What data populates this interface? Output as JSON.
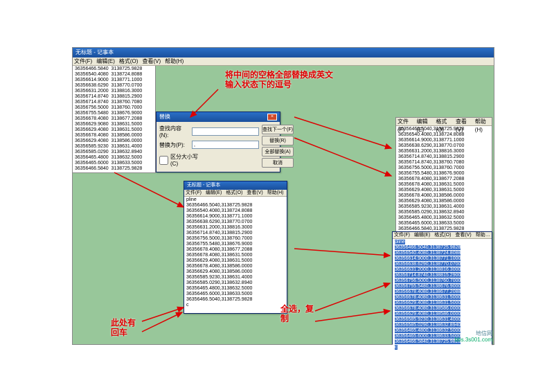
{
  "main_window": {
    "title": "无标题 - 记事本",
    "menu": [
      "文件(F)",
      "编辑(E)",
      "格式(O)",
      "查看(V)",
      "帮助(H)"
    ],
    "lines": [
      "36356466.5840  3138725.9828",
      "36356540.4080  3138724.8088",
      "36356614.9000  3138771.1000",
      "36356638.6290  3138770.0700",
      "36356631.2000  3138816.3000",
      "36356714.8740  3138815.2900",
      "36356714.8740  3138760.7080",
      "36356756.5000  3138760.7000",
      "36356755.5480  3138676.9000",
      "36356678.4080  3138677.2088",
      "36356629.9080  3138631.5000",
      "36356629.4080  3138631.5000",
      "36356678.4080  3138586.0000",
      "36356629.4080  3138586.0000",
      "36356585.9230  3138631.4000",
      "36356585.0290  3138632.8940",
      "36356465.4800  3138632.5000",
      "36356465.6000  3138633.5000",
      "36356466.5840  3138725.9828"
    ]
  },
  "dialog": {
    "title": "替换",
    "find_label": "查找内容(N):",
    "replace_label": "替换为(P):",
    "find_value": "",
    "replace_value": ",",
    "case_label": "区分大小写(C)",
    "btn_findnext": "查找下一个(F)",
    "btn_replace": "替换(R)",
    "btn_replaceall": "全部替换(A)",
    "btn_cancel": "取消"
  },
  "right_panel": {
    "menu": [
      "文件(F)",
      "编辑(E)",
      "格式(O)",
      "查看(V)",
      "帮助(H)"
    ],
    "lines": [
      "36356466.5040,3138725.9828",
      "36356540.4080,3138724.8088",
      "36356614.9000,3138771.1000",
      "36356638.6290,3138770.0700",
      "36356631.2000,3138816.3000",
      "36356714.8740,3138815.2900",
      "36356714.8740,3138760.7080",
      "36356756.5000,3138760.7000",
      "36356755.5480,3138676.9000",
      "36356678.4080,3138677.2088",
      "36356678.4080,3138631.5000",
      "36356629.4080,3138631.5000",
      "36356678.4080,3138586.0000",
      "36356629.4080,3138586.0000",
      "36356585.9230,3138631.4000",
      "36356585.0290,3138632.8940",
      "36356465.4800,3138632.5000",
      "36356465.6000,3138633.5000",
      "36356466.5840,3138725.9828"
    ]
  },
  "middle_notepad": {
    "title": "无标题 - 记事本",
    "menu": [
      "文件(F)",
      "编辑(E)",
      "格式(O)",
      "查看(V)",
      "帮助(H)"
    ],
    "first_line": "pline",
    "lines": [
      "36356466.5040,3138725.9828",
      "36356540.4080,3138724.8088",
      "36356614.9000,3138771.1000",
      "36356638.6290,3138770.0700",
      "36356631.2000,3138816.3000",
      "36356714.8740,3138815.2900",
      "36356756.5000,3138760.7000",
      "36356755.5480,3138676.9000",
      "36356678.4080,3138677.2088",
      "36356678.4080,3138631.5000",
      "36356629.4080,3138631.5000",
      "36356678.4080,3138586.0000",
      "36356629.4080,3138586.0000",
      "36356585.9230,3138631.4000",
      "36356585.0290,3138632.8940",
      "36356465.4800,3138632.5000",
      "36356465.6000,3138633.5000",
      "36356466.5040,3138725.9828"
    ],
    "last_line": "c"
  },
  "blue_notepad": {
    "menu": [
      "文件(F)",
      "编辑(E)",
      "格式(O)",
      "查看(V)",
      "帮助…"
    ],
    "first_line": "pline",
    "lines": [
      "36356466.5040,3138725.9828",
      "36356540.4080,3138724.8088",
      "36356614.9000,3138771.1000",
      "36356638.6290,3138770.0700",
      "36356631.2000,3138816.3000",
      "36356714.8740,3138815.2900",
      "36356756.5000,3138760.7000",
      "36356755.5480,3138676.9000",
      "36356678.4080,3138677.2088",
      "36356678.4080,3138631.5000",
      "36356629.4080,3138631.5000",
      "36356678.4080,3138586.0000",
      "36356629.4080,3138586.0000",
      "36356585.9230,3138631.4000",
      "36356585.0290,3138632.8940",
      "36356465.4800,3138632.5000",
      "36356465.6000,3138633.5000",
      "36356466.5840,3138725.9828"
    ],
    "last_line": "c"
  },
  "annotations": {
    "top": "将中间的空格全部替换成英文\n输入状态下的逗号",
    "left": "此处有\n回车",
    "right": "全选，复\n制"
  },
  "watermark": {
    "line1": "地信网",
    "line2": "bbs.3s001.com"
  }
}
